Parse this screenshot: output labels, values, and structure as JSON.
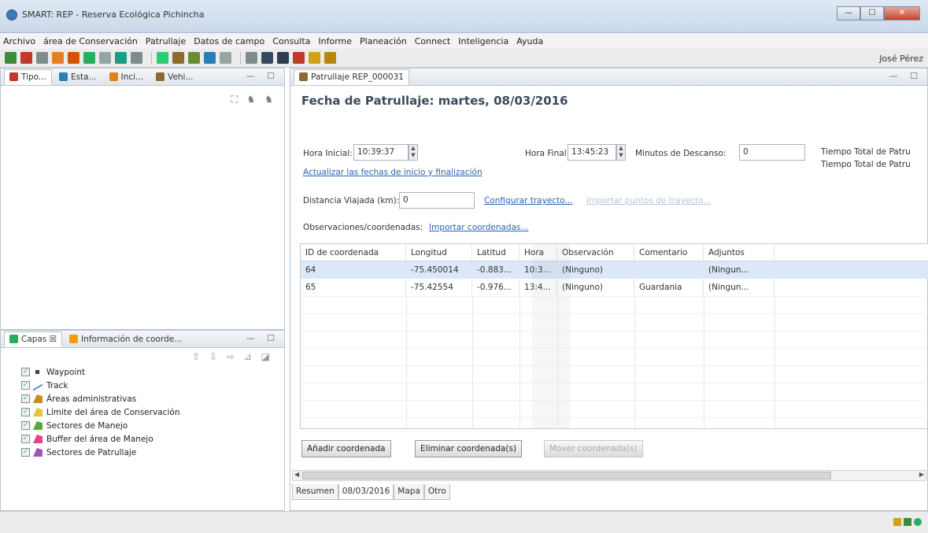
{
  "window": {
    "title": "SMART: REP - Reserva Ecológica Pichincha",
    "buttons": [
      "—",
      "☐",
      "✕"
    ]
  },
  "menubar": [
    "Archivo",
    "área de Conservación",
    "Patrullaje",
    "Datos de campo",
    "Consulta",
    "Informe",
    "Planeación",
    "Connect",
    "Inteligencia",
    "Ayuda"
  ],
  "toolbar": {
    "icons": [
      {
        "name": "map-icon",
        "color": "#3c8c3c"
      },
      {
        "name": "globe-icon",
        "color": "#c0392b"
      },
      {
        "name": "table-icon",
        "color": "#7f8c8d"
      },
      {
        "name": "patrol-icon",
        "color": "#e67e22"
      },
      {
        "name": "waypoint-icon",
        "color": "#d35400"
      },
      {
        "name": "pin-icon",
        "color": "#27ae60"
      },
      {
        "name": "grid-icon",
        "color": "#95a5a6"
      },
      {
        "name": "person-icon",
        "color": "#16a085"
      },
      {
        "name": "dropdown-grid-icon",
        "color": "#7f8c8d"
      },
      {
        "name": "flag-icon",
        "color": "#2ecc71"
      },
      {
        "name": "tree-icon",
        "color": "#8e6a2f"
      },
      {
        "name": "walker-icon",
        "color": "#6a8e2f"
      },
      {
        "name": "chart-icon",
        "color": "#2980b9"
      },
      {
        "name": "report-icon",
        "color": "#95a5a6"
      },
      {
        "name": "export-icon",
        "color": "#7f8c8d"
      },
      {
        "name": "calendar-icon",
        "color": "#34495e"
      },
      {
        "name": "query-icon",
        "color": "#2c3e50"
      },
      {
        "name": "intel-icon",
        "color": "#c0392b"
      },
      {
        "name": "plan-icon",
        "color": "#d4a017"
      },
      {
        "name": "connect-icon",
        "color": "#b8860b"
      }
    ],
    "user": "José Pérez"
  },
  "left_top": {
    "tabs": [
      {
        "label": "Tipo...",
        "icon": "type-icon",
        "color": "#c0392b"
      },
      {
        "label": "Esta...",
        "icon": "station-icon",
        "color": "#2980b9"
      },
      {
        "label": "Inci...",
        "icon": "incident-icon",
        "color": "#e67e22"
      },
      {
        "label": "Vehi...",
        "icon": "vehicle-icon",
        "color": "#8e6a2f"
      }
    ],
    "controls": "— ☐",
    "tools": "⛶ ♞ ♞"
  },
  "left_bottom": {
    "tabs": [
      {
        "label": "Capas ☒",
        "icon": "layers-icon",
        "color": "#27ae60"
      },
      {
        "label": "Información de coorde...",
        "icon": "info-icon",
        "color": "#f39c12"
      }
    ],
    "controls": "— ☐",
    "tools": "⇧ ⇩ ⇨  ⊿ ◪",
    "layers": [
      {
        "label": "Waypoint",
        "symbol": "point",
        "color": "#444444"
      },
      {
        "label": "Track",
        "symbol": "line",
        "color": "#4a7fd0"
      },
      {
        "label": "Áreas administrativas",
        "symbol": "poly",
        "color": "#c98a2b"
      },
      {
        "label": "Límite del área de Conservación",
        "symbol": "poly",
        "color": "#e6c63a"
      },
      {
        "label": "Sectores de Manejo",
        "symbol": "poly",
        "color": "#5aaa3a"
      },
      {
        "label": "Buffer del área de Manejo",
        "symbol": "poly",
        "color": "#e0458a"
      },
      {
        "label": "Sectores de Patrullaje",
        "symbol": "poly",
        "color": "#9b59b6"
      }
    ]
  },
  "editor": {
    "tab": "Patrullaje REP_000031",
    "controls": "— ☐",
    "heading": "Fecha de Patrullaje:  martes, 08/03/2016",
    "hora_inicio_label": "Hora Inicial:",
    "hora_inicio": "10:39:37",
    "hora_final_label": "Hora Final:",
    "hora_final": "13:45:23",
    "minutos_label": "Minutos de Descanso:",
    "minutos": "0",
    "tiempo_total_1": "Tiempo Total de Patru",
    "tiempo_total_2": "Tiempo Total de Patru",
    "actualizar_link": "Actualizar las fechas de inicio y finalización",
    "distancia_label": "Distancia Viajada (km):",
    "distancia": "0",
    "configurar_link": "Configurar trayecto...",
    "disabled_link": "Importar puntos de trayecto...",
    "observaciones_label": "Observaciones/coordenadas:",
    "importar_link": "Importar coordenadas...",
    "table": {
      "columns": [
        "ID de coordenada",
        "Longitud",
        "Latitud",
        "Hora",
        "Observación",
        "Comentario",
        "Adjuntos"
      ],
      "rows": [
        [
          "64",
          "-75.450014",
          "-0.883...",
          "10:3...",
          "(Ninguno)",
          "",
          "(Ningun..."
        ],
        [
          "65",
          "-75.42554",
          "-0.976...",
          "13:4...",
          "(Ninguno)",
          "Guardania",
          "(Ningun..."
        ]
      ]
    },
    "buttons": {
      "add": "Añadir coordenada",
      "remove": "Eliminar coordenada(s)",
      "move": "Mover coordenada(s)"
    },
    "bottom_tabs": [
      "Resumen",
      "08/03/2016",
      "Mapa",
      "Otro"
    ]
  }
}
